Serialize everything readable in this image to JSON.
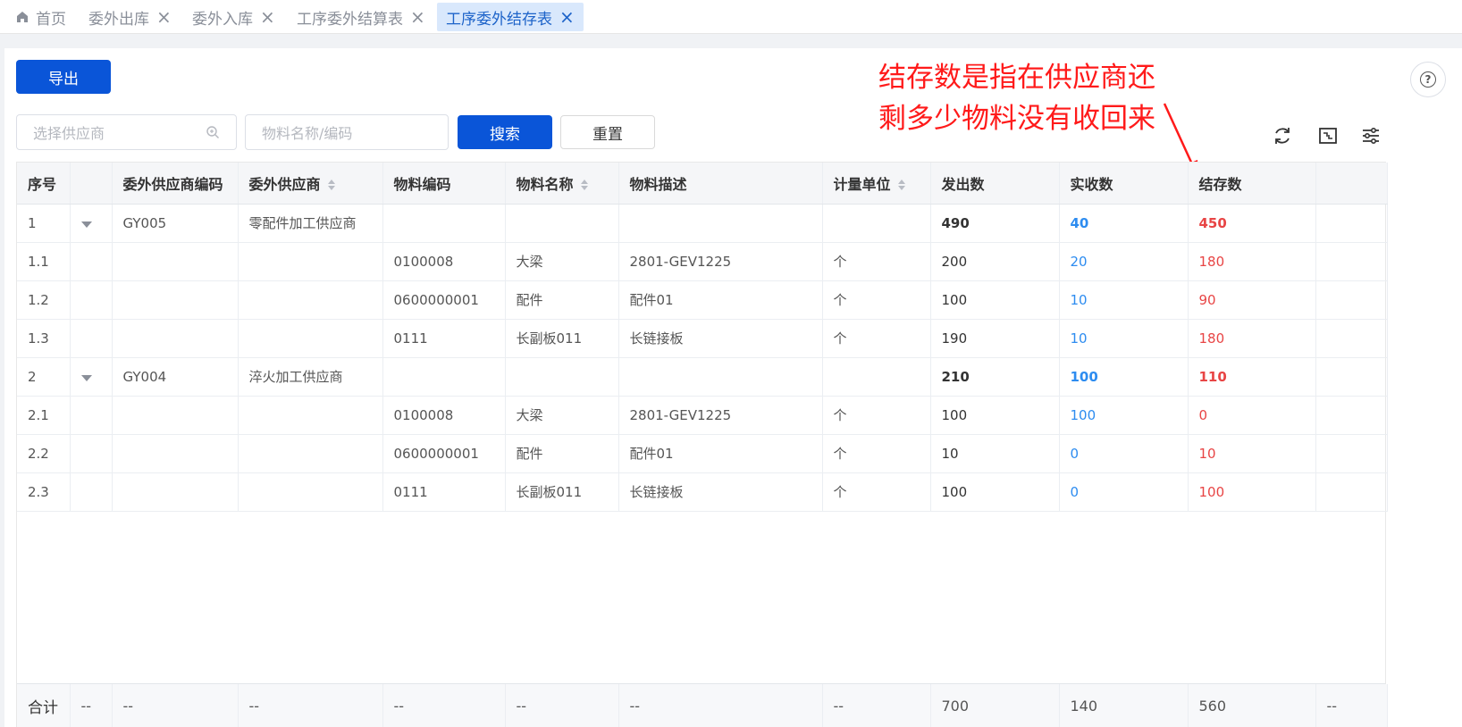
{
  "tabs": [
    {
      "label": "首页",
      "closable": false,
      "active": false
    },
    {
      "label": "委外出库",
      "closable": true,
      "active": false
    },
    {
      "label": "委外入库",
      "closable": true,
      "active": false
    },
    {
      "label": "工序委外结算表",
      "closable": true,
      "active": false
    },
    {
      "label": "工序委外结存表",
      "closable": true,
      "active": true
    }
  ],
  "toolbar": {
    "export_label": "导出",
    "supplier_placeholder": "选择供应商",
    "material_placeholder": "物料名称/编码",
    "search_label": "搜索",
    "reset_label": "重置"
  },
  "annotation": {
    "line1": "结存数是指在供应商还",
    "line2": "剩多少物料没有收回来",
    "color": "#ff1a1a"
  },
  "columns": [
    "序号",
    "",
    "委外供应商编码",
    "委外供应商",
    "物料编码",
    "物料名称",
    "物料描述",
    "计量单位",
    "发出数",
    "实收数",
    "结存数",
    ""
  ],
  "rows": [
    {
      "seq": "1",
      "expand": true,
      "sup_code": "GY005",
      "supplier": "零配件加工供应商",
      "mat_code": "",
      "mat_name": "",
      "desc": "",
      "unit": "",
      "sent": "490",
      "received": "40",
      "balance": "450"
    },
    {
      "seq": "1.1",
      "expand": false,
      "sup_code": "",
      "supplier": "",
      "mat_code": "0100008",
      "mat_name": "大梁",
      "desc": "2801-GEV1225",
      "unit": "个",
      "sent": "200",
      "received": "20",
      "balance": "180"
    },
    {
      "seq": "1.2",
      "expand": false,
      "sup_code": "",
      "supplier": "",
      "mat_code": "0600000001",
      "mat_name": "配件",
      "desc": "配件01",
      "unit": "个",
      "sent": "100",
      "received": "10",
      "balance": "90"
    },
    {
      "seq": "1.3",
      "expand": false,
      "sup_code": "",
      "supplier": "",
      "mat_code": "0111",
      "mat_name": "长副板011",
      "desc": "长链接板",
      "unit": "个",
      "sent": "190",
      "received": "10",
      "balance": "180"
    },
    {
      "seq": "2",
      "expand": true,
      "sup_code": "GY004",
      "supplier": "淬火加工供应商",
      "mat_code": "",
      "mat_name": "",
      "desc": "",
      "unit": "",
      "sent": "210",
      "received": "100",
      "balance": "110"
    },
    {
      "seq": "2.1",
      "expand": false,
      "sup_code": "",
      "supplier": "",
      "mat_code": "0100008",
      "mat_name": "大梁",
      "desc": "2801-GEV1225",
      "unit": "个",
      "sent": "100",
      "received": "100",
      "balance": "0"
    },
    {
      "seq": "2.2",
      "expand": false,
      "sup_code": "",
      "supplier": "",
      "mat_code": "0600000001",
      "mat_name": "配件",
      "desc": "配件01",
      "unit": "个",
      "sent": "10",
      "received": "0",
      "balance": "10"
    },
    {
      "seq": "2.3",
      "expand": false,
      "sup_code": "",
      "supplier": "",
      "mat_code": "0111",
      "mat_name": "长副板011",
      "desc": "长链接板",
      "unit": "个",
      "sent": "100",
      "received": "0",
      "balance": "100"
    }
  ],
  "totals": [
    "合计",
    "--",
    "--",
    "--",
    "--",
    "--",
    "--",
    "--",
    "700",
    "140",
    "560",
    "--"
  ],
  "colors": {
    "primary": "#0a55d8",
    "received": "#2d8cf0",
    "balance": "#e84545",
    "active_tab_bg": "#d9e8fc"
  },
  "icons": {
    "home": "home-icon",
    "close": "close-icon",
    "refresh": "refresh-icon",
    "fullscreen": "fullscreen-icon",
    "settings": "column-settings-icon",
    "help": "help-icon"
  }
}
